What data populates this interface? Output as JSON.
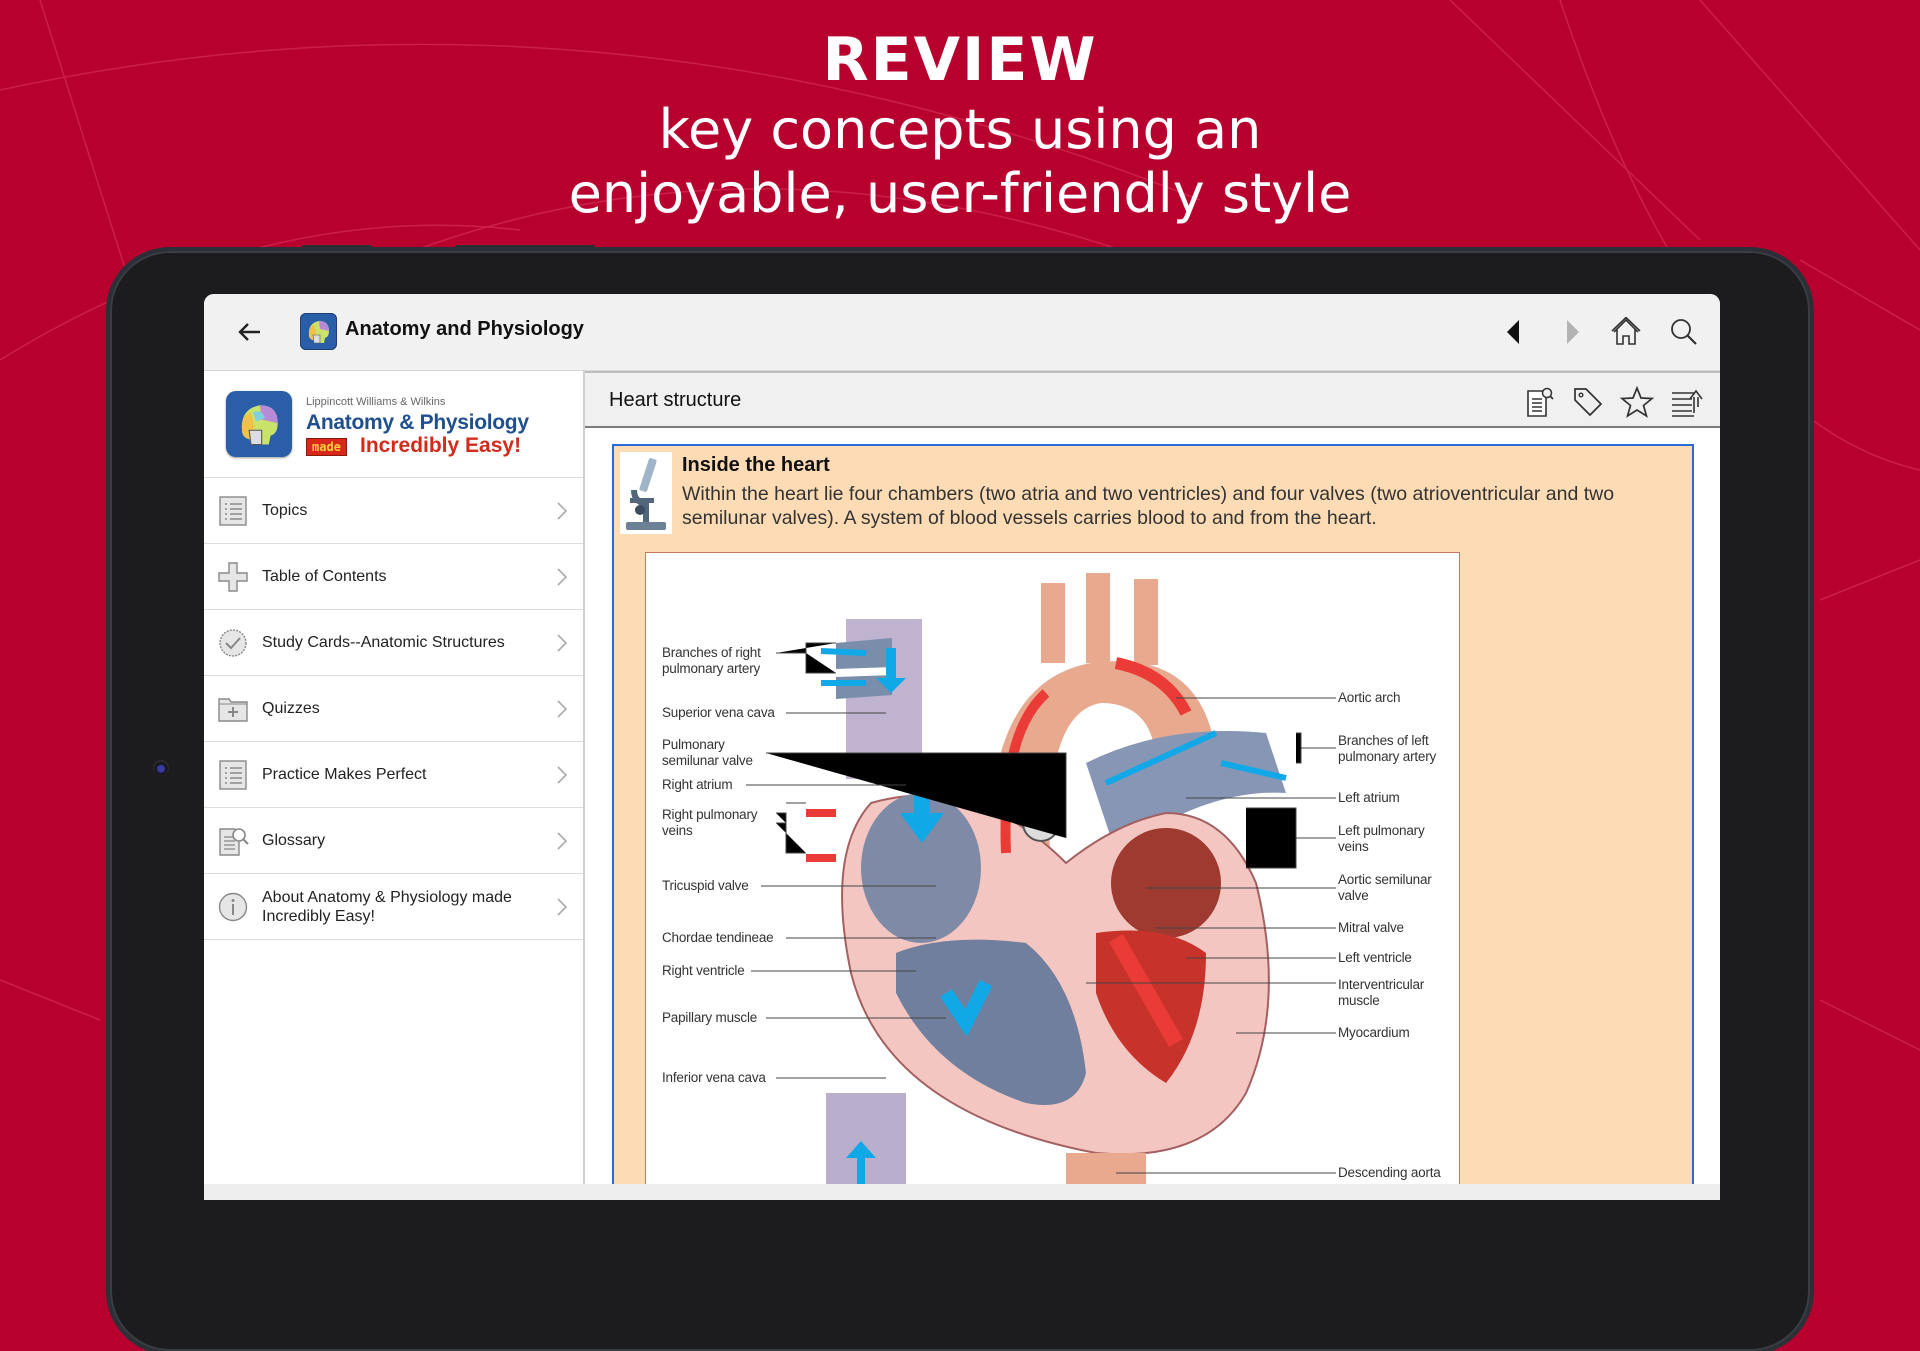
{
  "promo": {
    "headline": "REVIEW",
    "subline1": "key concepts using an",
    "subline2": "enjoyable, user-friendly style",
    "background_color": "#b8002f"
  },
  "appbar": {
    "back_icon": "arrow-left-icon",
    "title": "Anatomy and Physiology",
    "nav": [
      {
        "name": "previous",
        "icon": "triangle-left-icon",
        "state": "enabled"
      },
      {
        "name": "next",
        "icon": "triangle-right-icon",
        "state": "disabled"
      },
      {
        "name": "home",
        "icon": "home-icon"
      },
      {
        "name": "search",
        "icon": "search-icon"
      }
    ]
  },
  "sidebar": {
    "brand": {
      "publisher": "Lippincott Williams & Wilkins",
      "title_line1": "Anatomy & Physiology",
      "made_badge": "made",
      "title_line2": "Incredibly Easy!"
    },
    "items": [
      {
        "label": "Topics",
        "icon": "list-icon"
      },
      {
        "label": "Table of Contents",
        "icon": "cross-icon"
      },
      {
        "label": "Study Cards--Anatomic Structures",
        "icon": "check-badge-icon"
      },
      {
        "label": "Quizzes",
        "icon": "folder-plus-icon"
      },
      {
        "label": "Practice Makes Perfect",
        "icon": "list-icon"
      },
      {
        "label": "Glossary",
        "icon": "document-search-icon"
      },
      {
        "label": "About Anatomy & Physiology made Incredibly Easy!",
        "icon": "info-icon"
      }
    ]
  },
  "main": {
    "section_title": "Heart structure",
    "toolbar": [
      {
        "name": "notes",
        "icon": "document-search-icon"
      },
      {
        "name": "tag",
        "icon": "tag-icon"
      },
      {
        "name": "favorite",
        "icon": "star-icon"
      },
      {
        "name": "outline",
        "icon": "text-up-arrow-icon"
      }
    ],
    "card": {
      "title": "Inside the heart",
      "body": "Within the heart lie four chambers (two atria and two ventricles) and four valves (two atrioventricular and two semilunar valves). A system of blood vessels carries blood to and from the heart.",
      "thumbnail_icon": "microscope-icon",
      "background": "#fddcb5",
      "border": "#2a6ad8"
    },
    "figure": {
      "left_labels": [
        "Branches of right\npulmonary artery",
        "Superior vena cava",
        "Pulmonary\nsemilunar valve",
        "Right atrium",
        "Right pulmonary\nveins",
        "Tricuspid valve",
        "Chordae tendineae",
        "Right ventricle",
        "Papillary muscle",
        "Inferior vena cava"
      ],
      "right_labels": [
        "Aortic arch",
        "Branches of left\npulmonary artery",
        "Left atrium",
        "Left pulmonary\nveins",
        "Aortic semilunar\nvalve",
        "Mitral valve",
        "Left ventricle",
        "Interventricular\nmuscle",
        "Myocardium",
        "Descending aorta"
      ],
      "zoom_icon": "zoom-in-icon"
    }
  }
}
